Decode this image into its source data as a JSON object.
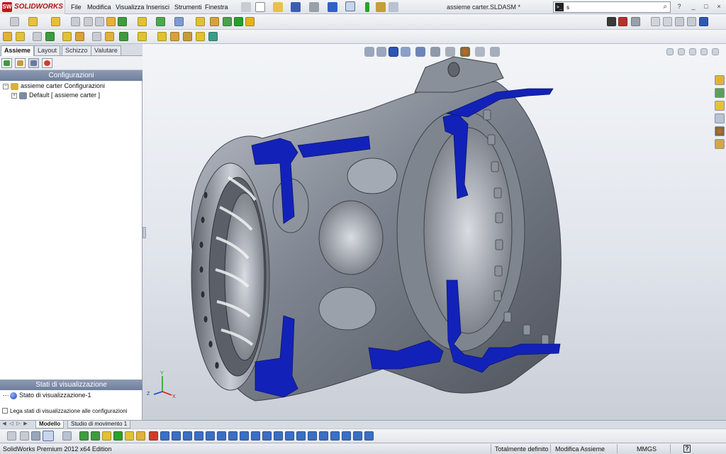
{
  "app": {
    "brand": "SOLIDWORKS",
    "logo_mark": "SW",
    "document_title": "assieme carter.SLDASM *"
  },
  "menu": {
    "items": [
      "File",
      "Modifica",
      "Visualizza",
      "Inserisci",
      "Strumenti",
      "Finestra"
    ]
  },
  "search": {
    "value": "s",
    "command_icon": "command-prompt-icon",
    "search_icon": "magnifier-icon"
  },
  "window_controls": {
    "help": "?",
    "minimize": "_",
    "restore": "□",
    "close": "×"
  },
  "left_panel": {
    "tabs": [
      "Assieme",
      "Layout",
      "Schizzo",
      "Valutare"
    ],
    "active_tab": "Assieme",
    "icon_tabs": [
      "feature-manager-icon",
      "property-manager-icon",
      "configuration-manager-icon",
      "display-manager-icon"
    ],
    "configurations_header": "Configurazioni",
    "config_tree": {
      "root": "assieme carter Configurazioni",
      "child": "Default [ assieme carter ]"
    },
    "display_states_header": "Stati di visualizzazione",
    "display_state": "Stato di visualizzazione-1",
    "link_checkbox_label": "Lega stati di visualizzazione alle configurazioni",
    "link_checkbox_checked": false
  },
  "graphics": {
    "triad_labels": {
      "x": "X",
      "y": "Y",
      "z": "Z"
    }
  },
  "bottom_tabs": {
    "items": [
      "Modello",
      "Studio di movimento 1"
    ],
    "active": "Modello"
  },
  "status": {
    "product": "SolidWorks Premium 2012 x64 Edition",
    "definition": "Totalmente definito",
    "mode": "Modifica Assieme",
    "units": "MMGS",
    "help_icon": "?"
  },
  "colors": {
    "brand_red": "#c3151b",
    "section_cut_blue": "#1222b8",
    "model_grey": "#8d929c",
    "panel_header": "#7889a6"
  }
}
